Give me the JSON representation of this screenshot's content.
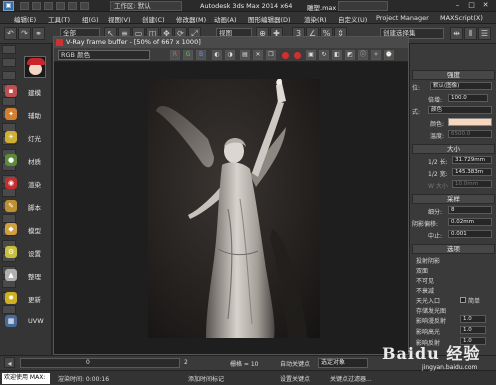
{
  "titlebar": {
    "workspace": "工作区: 默认",
    "app_title": "Autodesk 3ds Max  2014 x64",
    "file_name": "雕塑.max"
  },
  "menus": [
    "编辑(E)",
    "工具(T)",
    "组(G)",
    "视图(V)",
    "创建(C)",
    "修改器(M)",
    "动画(A)",
    "图形编辑器(D)",
    "渲染(R)",
    "自定义(U)",
    "Project Manager",
    "MAXScript(X)"
  ],
  "toolbar": {
    "selection_filter": "全部",
    "view_dropdown": "视图",
    "selection_set": "创建选择集"
  },
  "sidebar": {
    "items": [
      {
        "label": "建模",
        "icon": "box-icon"
      },
      {
        "label": "辅助",
        "icon": "helper-icon"
      },
      {
        "label": "灯光",
        "icon": "light-icon"
      },
      {
        "label": "材质",
        "icon": "material-icon"
      },
      {
        "label": "渲染",
        "icon": "render-icon"
      },
      {
        "label": "脚本",
        "icon": "script-icon"
      },
      {
        "label": "模型",
        "icon": "model-icon"
      },
      {
        "label": "设置",
        "icon": "settings-icon"
      },
      {
        "label": "整理",
        "icon": "organize-icon"
      },
      {
        "label": "更新",
        "icon": "update-icon"
      },
      {
        "label": "UVW",
        "icon": "uvw-icon"
      }
    ]
  },
  "vfb": {
    "title": "V-Ray frame buffer - [50% of 667 x 1000]",
    "channel": "RGB 颜色",
    "channel_buttons": [
      "R",
      "G",
      "B"
    ]
  },
  "rpanel": {
    "section_intensity": "强度",
    "mode_label": "位:",
    "mode_value": "默认(图像)",
    "multiplier_label": "倍增:",
    "multiplier_value": "100.0",
    "color_mode_label": "式:",
    "color_mode_value": "颜色",
    "color_label": "颜色:",
    "temperature_label": "温度:",
    "temperature_value": "6500.0",
    "section_size": "大小",
    "half_length_label": "1/2 长:",
    "half_length_value": "31.729mm",
    "half_width_label": "1/2 宽:",
    "half_width_value": "145.383m",
    "w_size_label": "W 大小",
    "w_size_value": "10.0mm",
    "section_sampling": "采样",
    "subdivs_label": "细分:",
    "subdivs_value": "8",
    "shadow_bias_label": "阴影偏移:",
    "shadow_bias_value": "0.02mm",
    "cutoff_label": "中止:",
    "cutoff_value": "0.001",
    "section_options": "选项",
    "opt_cast_shadows": "投射阴影",
    "opt_double_sided": "双面",
    "opt_invisible": "不可见",
    "opt_no_decay": "不衰减",
    "opt_skylight_portal": "天光入口",
    "opt_simple": "简单",
    "opt_store_irradiance": "存储发光图",
    "opt_affect_diffuse": "影响漫反射",
    "opt_affect_diffuse_value": "1.0",
    "opt_affect_specular": "影响高光",
    "opt_affect_specular_value": "1.0",
    "opt_affect_reflections": "影响反射",
    "opt_affect_reflections_value": "1.0"
  },
  "colors": {
    "light_color": "#f7d6bd",
    "accent": "#c8262c"
  },
  "timeline": {
    "frame_start": "0",
    "frame_marker": "2",
    "grid_label": "栅格 = 10",
    "autokey_label": "自动关键点",
    "selection_label": "选定对象",
    "set_key_label": "设置关键点",
    "key_filter_label": "关键点过滤器..."
  },
  "status": {
    "maxscript": "欢迎使用 MAX:",
    "render_time": "渲染时间: 0:00:16",
    "add_time_tag": "添加时间标记"
  },
  "watermark": {
    "text": "Baidu 经验",
    "url": "jingyan.baidu.com"
  }
}
